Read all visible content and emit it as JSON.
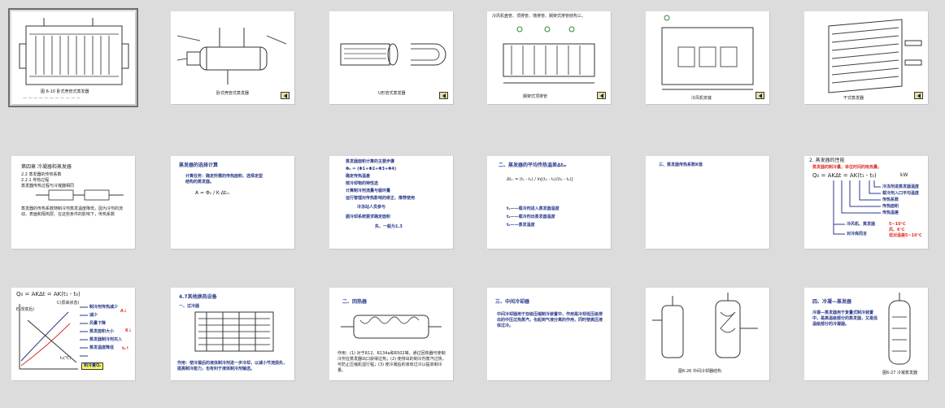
{
  "slides": [
    {
      "id": 1,
      "caption": "图 6-10 卧式壳管式蒸发器"
    },
    {
      "id": 2,
      "caption": "卧式壳管式蒸发器"
    },
    {
      "id": 3,
      "caption": "U形管式蒸发器"
    },
    {
      "id": 4,
      "header": "冷风机盘管、顶排管、墙排管、搁架式排管结构三。",
      "caption": "搁架式顶排管"
    },
    {
      "id": 5,
      "caption": "冷风机安装"
    },
    {
      "id": 6,
      "caption": "干式蒸发器"
    },
    {
      "id": 7,
      "lines": [
        "第四章 冷凝器和蒸发器",
        "2.2 蒸发器的传热系数",
        "2.2.1 传热过程",
        "蒸发器传热过程与冷凝器相同",
        "蒸发器的传热系数随制冷剂蒸发温度降低，因为冷剂的流动、表面和隔热层、在这些条件的影响下，传热系数"
      ]
    },
    {
      "id": 8,
      "title": "蒸发器的选择计算",
      "line1": "计算任务：确定所需的传热面积、选择定型",
      "line2": "结构的蒸发器。",
      "formula": "A = Φ₀ / K·Δtₘ"
    },
    {
      "id": 9,
      "items": [
        "蒸发器面积计算的主要步骤",
        "Φ₀ = (Φ1+Φ2+Φ3+Φ4)",
        "确定传热温差",
        "按冷却物的特性选",
        "计算制冷剂流量与循环量",
        "运行管理对传热影响的修正、推荐使用",
        "冷冻站人员参与",
        "据冷却系统要求确定面积",
        "失、一般为1.3"
      ]
    },
    {
      "id": 10,
      "title": "二、蒸发器的平均传热温差Δtₘ",
      "formula": "Δtₘ = (t₁ - t₂) / ln[(t₁ - t₀)/(t₂ - t₀)]",
      "l1": "t₁——载冷剂进入蒸发器温度",
      "l2": "t₂——载冷剂出蒸发器温度",
      "l3": "t₀——蒸发温度"
    },
    {
      "id": 11,
      "text": "三、蒸发器传热系数K值"
    },
    {
      "id": 12,
      "title": "2. 蒸发器的性能",
      "subtitle": "蒸发器的制冷量，单位时间的吸热量。",
      "formula": "Q₀ = AKΔt = AK(t₁ - t₀)",
      "unit": "kW",
      "labels": [
        "冷冻剂进蒸发器温度",
        "载冷剂入口平均温度",
        "传热系数",
        "传热面积",
        "传热温差",
        "冷风机、蒸发器",
        "对冷库而言"
      ],
      "vals": [
        "5~10℃",
        "风、6℃",
        "低对温差5~10℃"
      ]
    },
    {
      "id": 13,
      "formula": "Q₀ = AKΔt = AK(t₁ - t₀)",
      "labels": [
        "制冷剂传热减少",
        "减少",
        "风量下降",
        "蒸发面积大小",
        "蒸发器制冷剂充入",
        "蒸发温度降低",
        "制冷量Q₀"
      ],
      "tags": [
        "A↓",
        "K↓",
        "t₀↑"
      ],
      "curveA": "C(原来状态)",
      "curveB": "E(改变后)",
      "axis": "t₀(℃)"
    },
    {
      "id": 14,
      "title": "4.7其他换热设备",
      "sub": "一、过冷器",
      "notes": "作用：使冷凝后的液体制冷剂进一步冷却，以减小节流损失，提高制冷能力，也有利于液体制冷剂输送。"
    },
    {
      "id": 15,
      "title": "二、回热器",
      "notes": "作用：(1) 对于R12、R134a和R502等，通过回热器可使制冷剂在蒸发器出口获得过热；(2) 使排出的制冷剂蒸汽过热，可防止压缩机湿行程；(3) 使冷凝后的液体过冷以提高制冷量。"
    },
    {
      "id": 16,
      "title": "三、中间冷却器",
      "notes": "中间冷却器用于双级压缩制冷装置中，作用是冷却低压级排出的中压过热蒸汽，也起到气液分离的作用，同时使高压液体过冷。"
    },
    {
      "id": 17,
      "caption": "图6-26 中间冷却器结构"
    },
    {
      "id": 18,
      "title": "四、冷凝—蒸发器",
      "notes": "冷凝—蒸发器用于复叠式制冷装置中，是高温级部分的蒸发器，又是低温级部分的冷凝器。",
      "caption": "图6-27 冷凝蒸发器"
    }
  ],
  "colors": {
    "blue": "#2a3a8a",
    "red": "#e0302a",
    "highlight": "#ffff55",
    "background": "#dcdcdc"
  },
  "icons": [
    "nav-arrow-icon"
  ]
}
